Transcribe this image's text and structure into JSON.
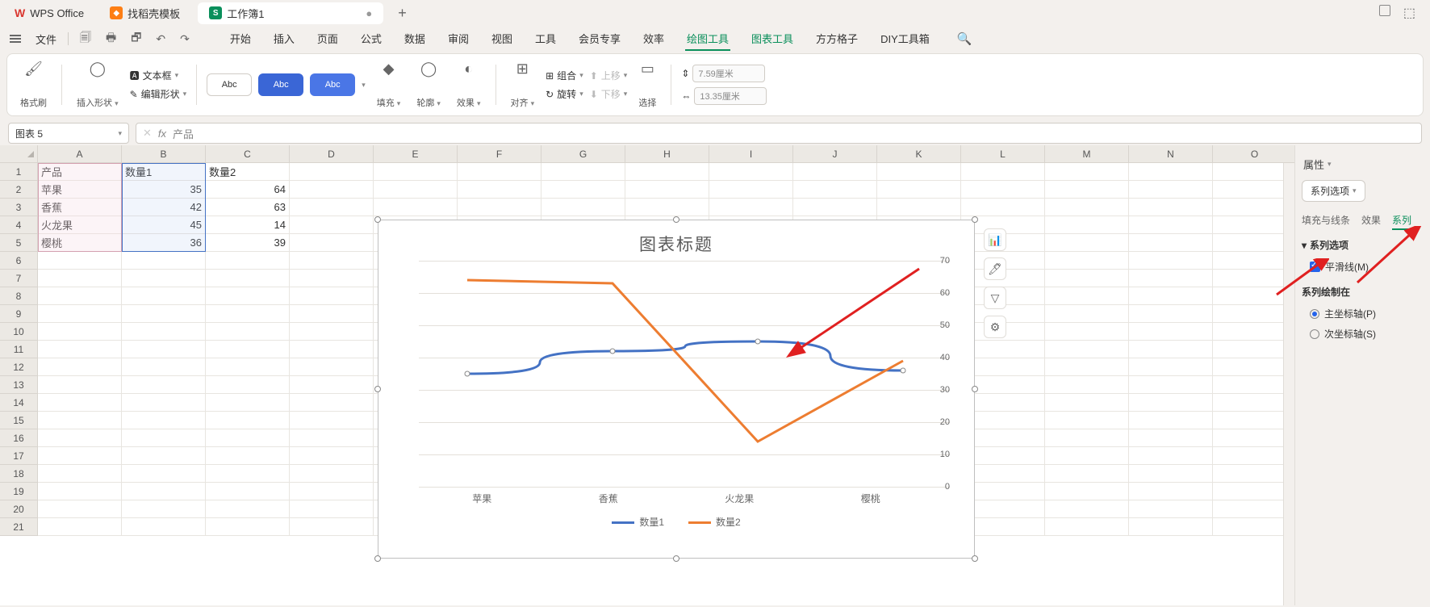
{
  "app": {
    "name": "WPS Office"
  },
  "tabs": {
    "template": "找稻壳模板",
    "workbook": "工作簿1",
    "add": "+"
  },
  "menu": {
    "file": "文件",
    "items": [
      "开始",
      "插入",
      "页面",
      "公式",
      "数据",
      "审阅",
      "视图",
      "工具",
      "会员专享",
      "效率",
      "绘图工具",
      "图表工具",
      "方方格子",
      "DIY工具箱"
    ]
  },
  "ribbon": {
    "format_painter": "格式刷",
    "insert_shape": "插入形状",
    "text_box": "文本框",
    "edit_shape": "编辑形状",
    "abc": "Abc",
    "fill": "填充",
    "outline": "轮廓",
    "effect": "效果",
    "align": "对齐",
    "rotate": "旋转",
    "group": "组合",
    "up": "上移",
    "down": "下移",
    "select": "选择",
    "width_label": "↕",
    "width_val": "7.59厘米",
    "height_label": "↔",
    "height_val": "13.35厘米"
  },
  "formula": {
    "name": "图表 5",
    "fx": "fx",
    "content": "产品"
  },
  "cols": [
    "A",
    "B",
    "C",
    "D",
    "E",
    "F",
    "G",
    "H",
    "I",
    "J",
    "K",
    "L",
    "M",
    "N",
    "O"
  ],
  "rows": 21,
  "data": {
    "r1": {
      "A": "产品",
      "B": "数量1",
      "C": "数量2"
    },
    "r2": {
      "A": "苹果",
      "B": "35",
      "C": "64"
    },
    "r3": {
      "A": "香蕉",
      "B": "42",
      "C": "63"
    },
    "r4": {
      "A": "火龙果",
      "B": "45",
      "C": "14"
    },
    "r5": {
      "A": "樱桃",
      "B": "36",
      "C": "39"
    }
  },
  "chart_data": {
    "type": "line",
    "title": "图表标题",
    "categories": [
      "苹果",
      "香蕉",
      "火龙果",
      "樱桃"
    ],
    "series": [
      {
        "name": "数量1",
        "values": [
          35,
          42,
          45,
          36
        ],
        "color": "#4472c4",
        "smooth": true
      },
      {
        "name": "数量2",
        "values": [
          64,
          63,
          14,
          39
        ],
        "color": "#ed7d31",
        "smooth": false
      }
    ],
    "ylim": [
      0,
      70
    ],
    "yticks": [
      0,
      10,
      20,
      30,
      40,
      50,
      60,
      70
    ]
  },
  "side": {
    "title": "属性",
    "dropdown": "系列选项",
    "tabs": [
      "填充与线条",
      "效果",
      "系列"
    ],
    "section1": "系列选项",
    "smooth": "平滑线(M)",
    "section2": "系列绘制在",
    "primary": "主坐标轴(P)",
    "secondary": "次坐标轴(S)"
  }
}
